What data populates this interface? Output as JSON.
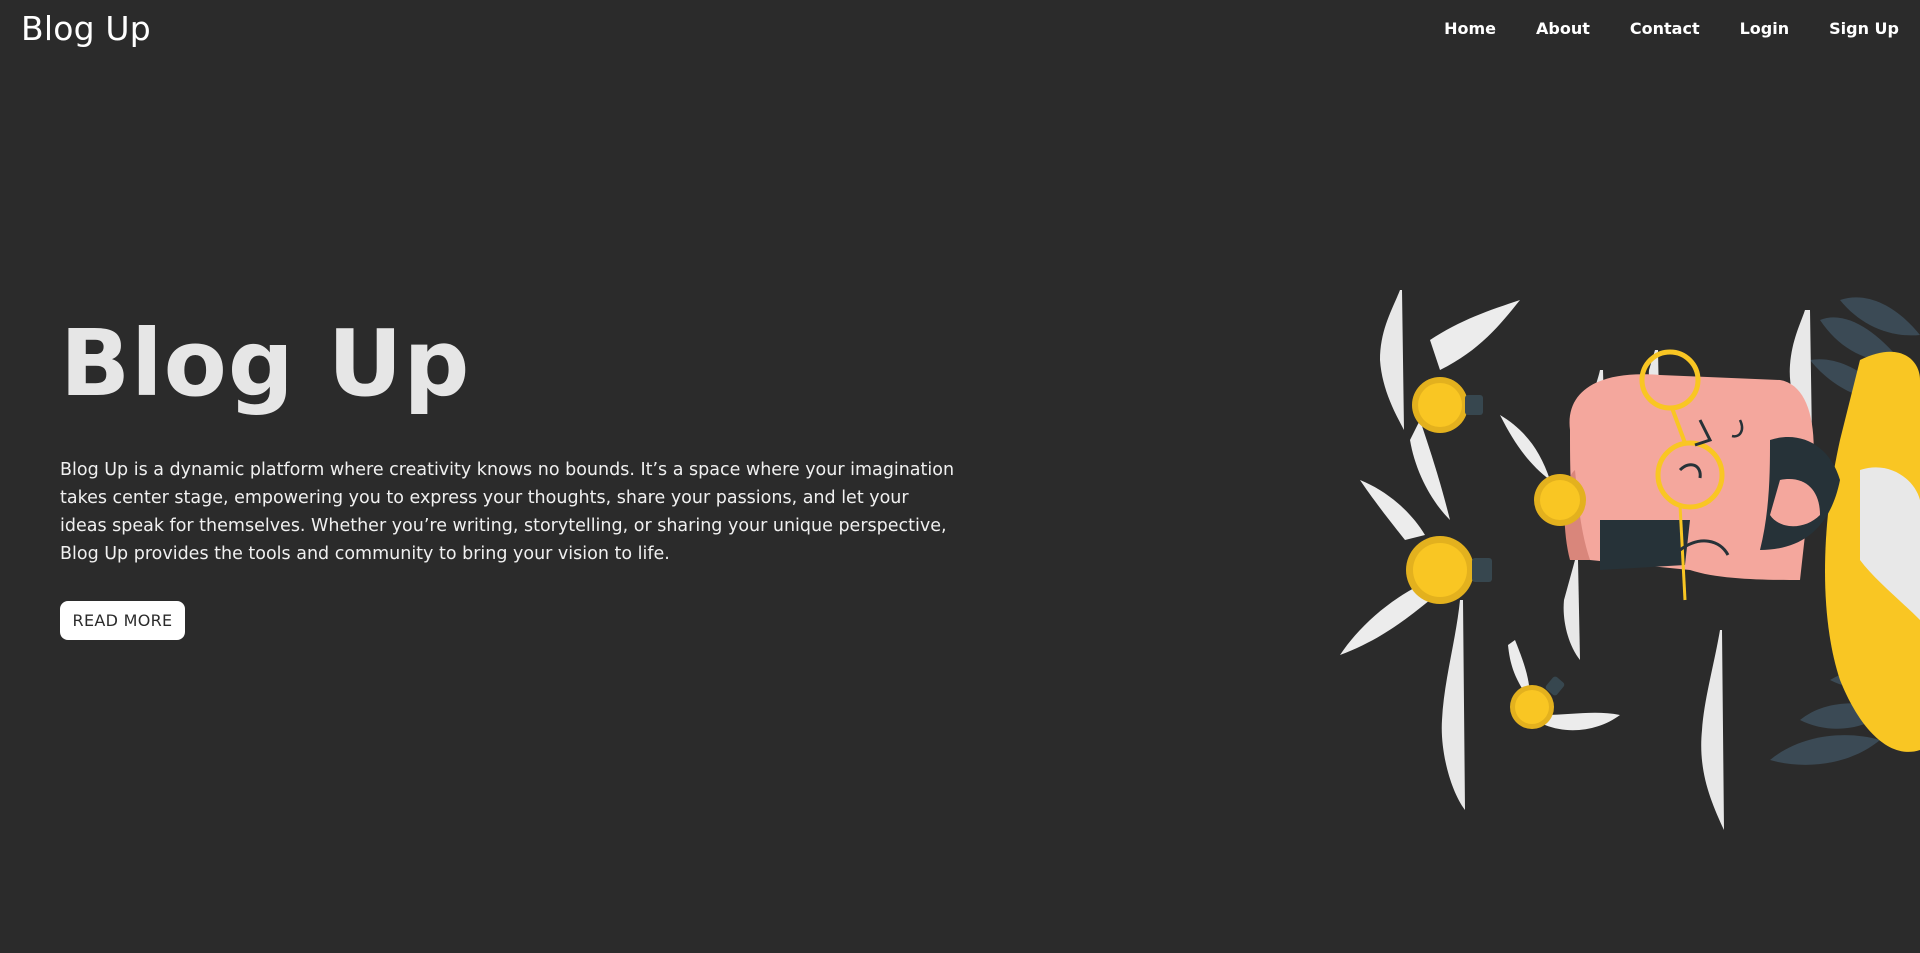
{
  "header": {
    "brand": "Blog Up",
    "nav": [
      {
        "label": "Home"
      },
      {
        "label": "About"
      },
      {
        "label": "Contact"
      },
      {
        "label": "Login"
      },
      {
        "label": "Sign Up"
      }
    ]
  },
  "hero": {
    "title": "Blog Up",
    "description": "Blog Up is a dynamic platform where creativity knows no bounds. It’s a space where your imagination takes center stage, empowering you to express your thoughts, share your passions, and let your ideas speak for themselves. Whether you’re writing, storytelling, or sharing your unique perspective, Blog Up provides the tools and community to bring your vision to life.",
    "button_label": "READ MORE",
    "illustration_icon": "thinking-person-lightbulbs-illustration"
  },
  "colors": {
    "background": "#2b2b2b",
    "text": "#ececec",
    "button_bg": "#ffffff",
    "accent_yellow": "#f9c623",
    "skin_pink": "#f4a79d",
    "dark_slate": "#263238"
  }
}
